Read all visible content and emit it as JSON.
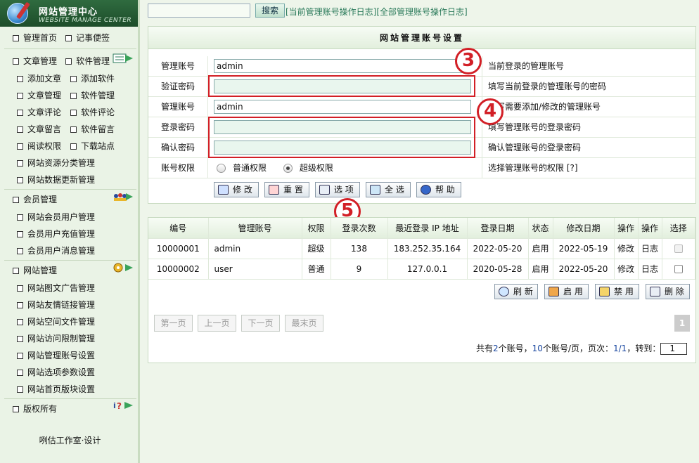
{
  "logo": {
    "title": "网站管理中心",
    "subtitle": "WEBSITE MANAGE CENTER"
  },
  "sidebar": {
    "top_items": [
      "管理首页",
      "记事便签"
    ],
    "cat1": {
      "items": [
        "文章管理",
        "软件管理"
      ],
      "subs": [
        [
          "添加文章",
          "添加软件"
        ],
        [
          "文章管理",
          "软件管理"
        ],
        [
          "文章评论",
          "软件评论"
        ],
        [
          "文章留言",
          "软件留言"
        ],
        [
          "阅读权限",
          "下载站点"
        ]
      ],
      "singles": [
        "网站资源分类管理",
        "网站数据更新管理"
      ]
    },
    "cat2": {
      "label": "会员管理",
      "subs": [
        "网站会员用户管理",
        "会员用户充值管理",
        "会员用户消息管理"
      ]
    },
    "cat3": {
      "label": "网站管理",
      "subs": [
        "网站图文广告管理",
        "网站友情链接管理",
        "网站空间文件管理",
        "网站访问限制管理",
        "网站管理账号设置",
        "网站选项参数设置",
        "网站首页版块设置"
      ]
    },
    "cat4": {
      "label": "版权所有"
    },
    "credit": "咧估工作室·设计"
  },
  "topbar": {
    "search_placeholder": "",
    "search_button": "搜索",
    "link1": "[当前管理账号操作日志]",
    "link2": "[全部管理账号操作日志]"
  },
  "form": {
    "title": "网站管理账号设置",
    "rows": [
      {
        "label": "管理账号",
        "value": "admin",
        "hint": "当前登录的管理账号"
      },
      {
        "label": "验证密码",
        "value": "",
        "hint": "填写当前登录的管理账号的密码"
      },
      {
        "label": "管理账号",
        "value": "admin",
        "hint": "填写需要添加/修改的管理账号"
      },
      {
        "label": "登录密码",
        "value": "",
        "hint": "填写管理账号的登录密码"
      },
      {
        "label": "确认密码",
        "value": "",
        "hint": "确认管理账号的登录密码"
      }
    ],
    "perm": {
      "label": "账号权限",
      "opt1": "普通权限",
      "opt2": "超级权限",
      "selected": "超级权限",
      "hint": "选择管理账号的权限 [?]"
    },
    "buttons": [
      "修 改",
      "重 置",
      "选 项",
      "全 选",
      "帮 助"
    ]
  },
  "badges": [
    "3",
    "4",
    "5"
  ],
  "list": {
    "headers": [
      "编号",
      "管理账号",
      "权限",
      "登录次数",
      "最近登录 IP 地址",
      "登录日期",
      "状态",
      "修改日期",
      "操作",
      "操作",
      "选择"
    ],
    "rows": [
      {
        "id": "10000001",
        "account": "admin",
        "perm": "超级",
        "count": "138",
        "ip": "183.252.35.164",
        "login": "2022-05-20",
        "status": "启用",
        "modified": "2022-05-19",
        "op1": "修改",
        "op2": "日志",
        "checkbox_disabled": true
      },
      {
        "id": "10000002",
        "account": "user",
        "perm": "普通",
        "count": "9",
        "ip": "127.0.0.1",
        "login": "2020-05-28",
        "status": "启用",
        "modified": "2022-05-20",
        "op1": "修改",
        "op2": "日志",
        "checkbox_disabled": false
      }
    ],
    "actions": [
      "刷 新",
      "启 用",
      "禁 用",
      "删 除"
    ],
    "pager": {
      "first": "第一页",
      "prev": "上一页",
      "next": "下一页",
      "last": "最末页",
      "current": "1",
      "t1": "共有",
      "total": "2",
      "t2": "个账号，",
      "per": "10",
      "t3": "个账号/页，页次：",
      "page": "1/1",
      "t4": "，转到：",
      "goto": "1"
    }
  },
  "colors": {
    "accent": "#2f6b3f",
    "highlight": "#d21f26",
    "link": "#2a7a5a"
  }
}
